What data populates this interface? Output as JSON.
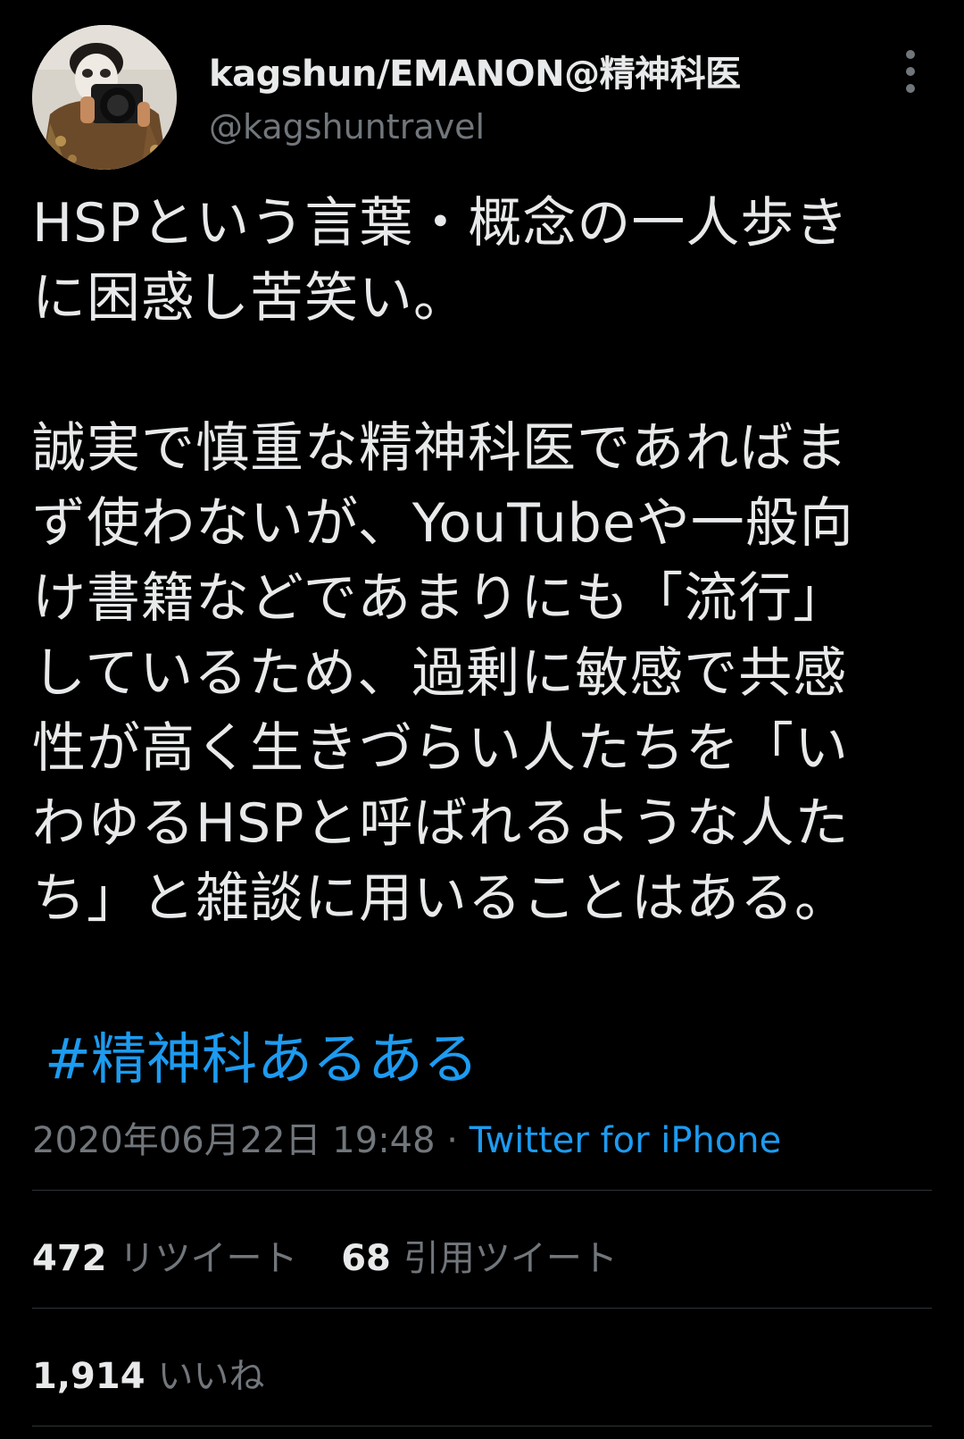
{
  "author": {
    "display_name": "kagshun/EMANON@精神科医",
    "handle": "@kagshuntravel",
    "avatar_icon": "user-avatar-photo"
  },
  "more_icon": "more-vertical-icon",
  "tweet": {
    "lines": [
      "HSPという言葉・概念の一人歩き",
      "に困惑し苦笑い。",
      "",
      "誠実で慎重な精神科医であればま",
      "ず使わないが、YouTubeや一般向",
      "け書籍などであまりにも「流行」",
      "しているため、過剰に敏感で共感",
      "性が高く生きづらい人たちを「い",
      "わゆるHSPと呼ばれるような人た",
      "ち」と雑談に用いることはある。"
    ],
    "hashtag": "#精神科あるある",
    "timestamp": "2020年06月22日 19:48",
    "separator": " · ",
    "source": "Twitter for iPhone"
  },
  "stats": {
    "retweets_count": "472",
    "retweets_label": "リツイート",
    "quotes_count": "68",
    "quotes_label": "引用ツイート",
    "likes_count": "1,914",
    "likes_label": "いいね"
  },
  "colors": {
    "background": "#000000",
    "text": "#e7e9ea",
    "secondary": "#71767b",
    "link": "#1d9bf0",
    "divider": "#2f3336"
  }
}
